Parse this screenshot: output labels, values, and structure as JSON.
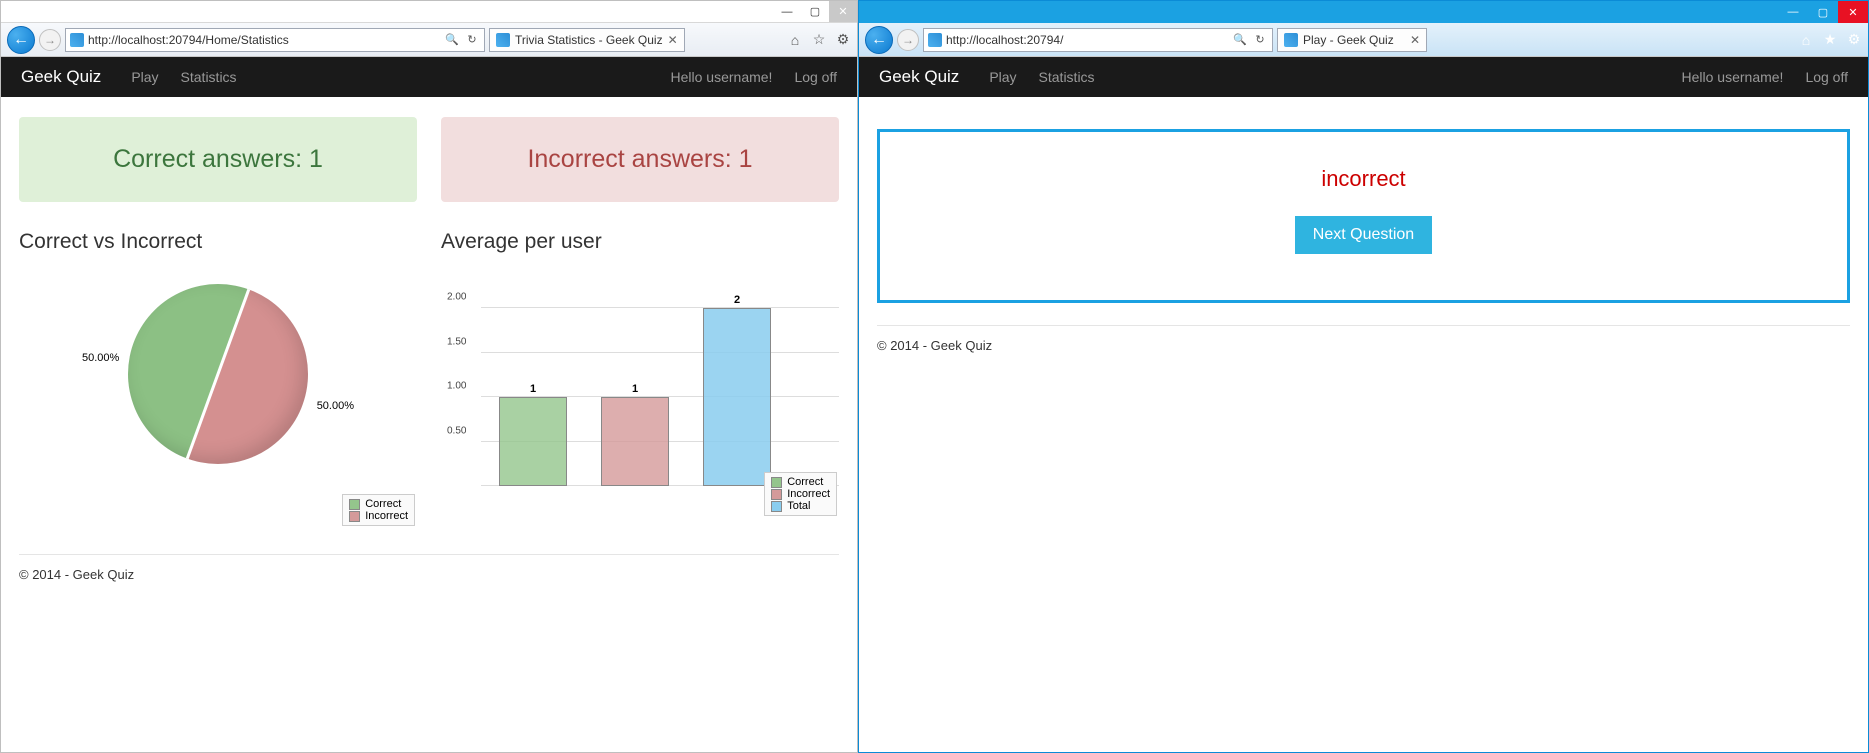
{
  "windows": {
    "left": {
      "url": "http://localhost:20794/Home/Statistics",
      "tab_title": "Trivia Statistics - Geek Quiz"
    },
    "right": {
      "url": "http://localhost:20794/",
      "tab_title": "Play - Geek Quiz"
    }
  },
  "nav": {
    "brand": "Geek Quiz",
    "play": "Play",
    "stats": "Statistics",
    "greeting": "Hello username!",
    "logoff": "Log off"
  },
  "stats": {
    "correct_panel": "Correct answers: 1",
    "incorrect_panel": "Incorrect answers: 1",
    "pie_title": "Correct vs Incorrect",
    "bar_title": "Average per user",
    "pct_left": "50.00%",
    "pct_right": "50.00%",
    "legend_correct": "Correct",
    "legend_incorrect": "Incorrect",
    "legend_total": "Total",
    "bar_values": {
      "correct": "1",
      "incorrect": "1",
      "total": "2"
    },
    "yticks": {
      "t0": "0.50",
      "t1": "1.00",
      "t2": "1.50",
      "t3": "2.00"
    }
  },
  "play": {
    "result": "incorrect",
    "next_btn": "Next Question"
  },
  "footer": "© 2014 - Geek Quiz",
  "chart_data": [
    {
      "type": "pie",
      "title": "Correct vs Incorrect",
      "categories": [
        "Correct",
        "Incorrect"
      ],
      "values": [
        50.0,
        50.0
      ],
      "series": [
        {
          "name": "Correct",
          "values": [
            50.0
          ]
        },
        {
          "name": "Incorrect",
          "values": [
            50.0
          ]
        }
      ]
    },
    {
      "type": "bar",
      "title": "Average per user",
      "categories": [
        "Correct",
        "Incorrect",
        "Total"
      ],
      "values": [
        1,
        1,
        2
      ],
      "ylim": [
        0,
        2.5
      ],
      "ylabel": "",
      "xlabel": ""
    }
  ]
}
